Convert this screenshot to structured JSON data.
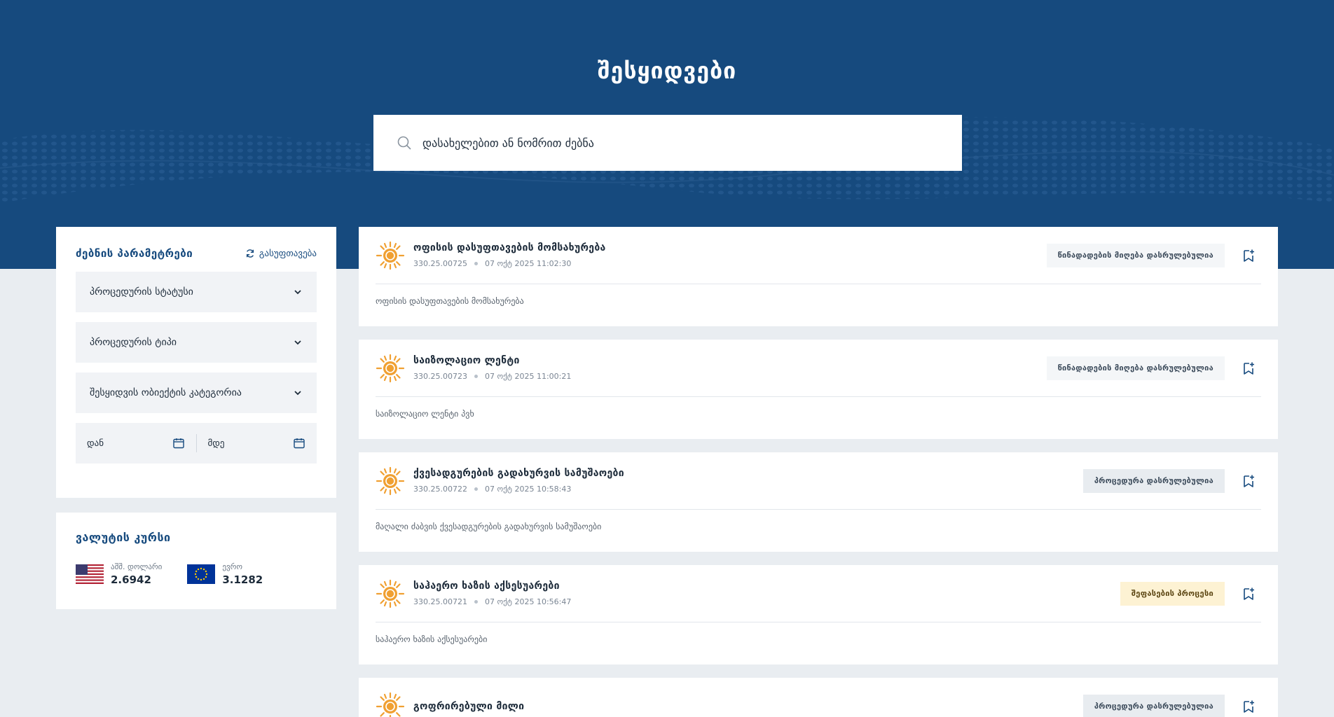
{
  "header": {
    "title": "შესყიდვები",
    "search_placeholder": "დასახელებით ან ნომრით ძებნა"
  },
  "filters": {
    "title": "ძებნის პარამეტრები",
    "reset_label": "გასუფთავება",
    "selects": [
      {
        "label": "პროცედურის სტატუსი"
      },
      {
        "label": "პროცედურის ტიპი"
      },
      {
        "label": "შესყიდვის ობიექტის კატეგორია"
      }
    ],
    "date_from": "დან",
    "date_to": "მდე"
  },
  "currency": {
    "title": "ვალუტის კურსი",
    "rates": [
      {
        "name": "აშშ. დოლარი",
        "value": "2.6942",
        "flag": "us-flag"
      },
      {
        "name": "ევრო",
        "value": "3.1282",
        "flag": "eu-flag"
      }
    ]
  },
  "procurements": [
    {
      "title": "ოფისის დასუფთავების მომსახურება",
      "code": "330.25.00725",
      "date": "07 ოქტ 2025 11:02:30",
      "status": "წინადადების მიღება დასრულებულია",
      "description": "ოფისის დასუფთავების მომსახურება"
    },
    {
      "title": "საიზოლაციო ლენტი",
      "code": "330.25.00723",
      "date": "07 ოქტ 2025 11:00:21",
      "status": "წინადადების მიღება დასრულებულია",
      "description": "საიზოლაციო ლენტი პვხ"
    },
    {
      "title": "ქვესადგურების გადახურვის სამუშაოები",
      "code": "330.25.00722",
      "date": "07 ოქტ 2025 10:58:43",
      "status": "პროცედურა დასრულებულია",
      "description": "მაღალი ძაბვის ქვესადგურების გადახურვის სამუშაოები"
    },
    {
      "title": "საჰაერო ხაზის აქსესუარები",
      "code": "330.25.00721",
      "date": "07 ოქტ 2025 10:56:47",
      "status": "შეფასების პროცესი",
      "description": "საჰაერო ხაზის აქსესუარები"
    },
    {
      "title": "გოფრირებული მილი",
      "code": "",
      "date": "",
      "status": "პროცედურა დასრულებულია",
      "description": ""
    }
  ],
  "colors": {
    "brand": "#164a7e",
    "accent_logo": "#f0a032",
    "status_pending_bg": "#fdf2d3"
  }
}
